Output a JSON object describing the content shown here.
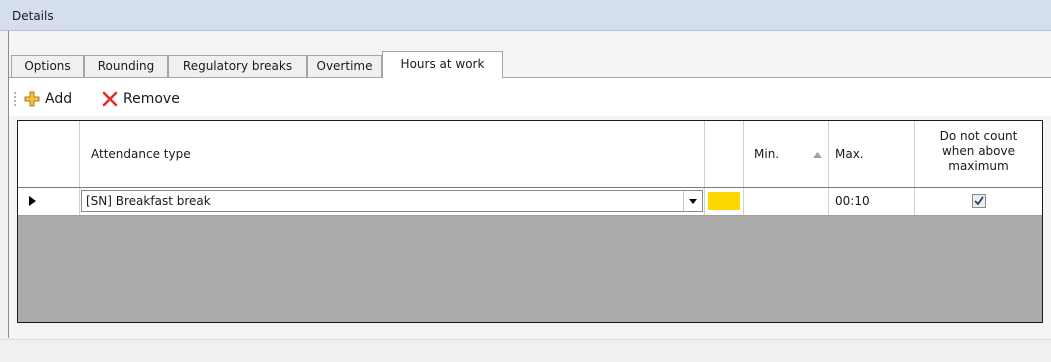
{
  "header": {
    "title": "Details"
  },
  "tabs": [
    {
      "label": "Options"
    },
    {
      "label": "Rounding"
    },
    {
      "label": "Regulatory breaks"
    },
    {
      "label": "Overtime"
    },
    {
      "label": "Hours at work",
      "active": true
    }
  ],
  "toolbar": {
    "add_label": "Add",
    "remove_label": "Remove"
  },
  "grid": {
    "columns": {
      "attendance_type": "Attendance type",
      "min": "Min.",
      "max": "Max.",
      "do_not_count_1": "Do not count",
      "do_not_count_2": "when above",
      "do_not_count_3": "maximum"
    },
    "sort": {
      "column": "Min.",
      "direction": "ascending"
    },
    "rows": [
      {
        "attendance_type": "[SN]  Breakfast break",
        "color": "#ffd700",
        "min": "",
        "max": "00:10",
        "do_not_count_when_above_maximum": true
      }
    ]
  },
  "colors": {
    "header_bg": "#d4deee",
    "swatch": "#ffd700",
    "remove_icon": "#e0302a",
    "add_icon": "#f0b020"
  }
}
